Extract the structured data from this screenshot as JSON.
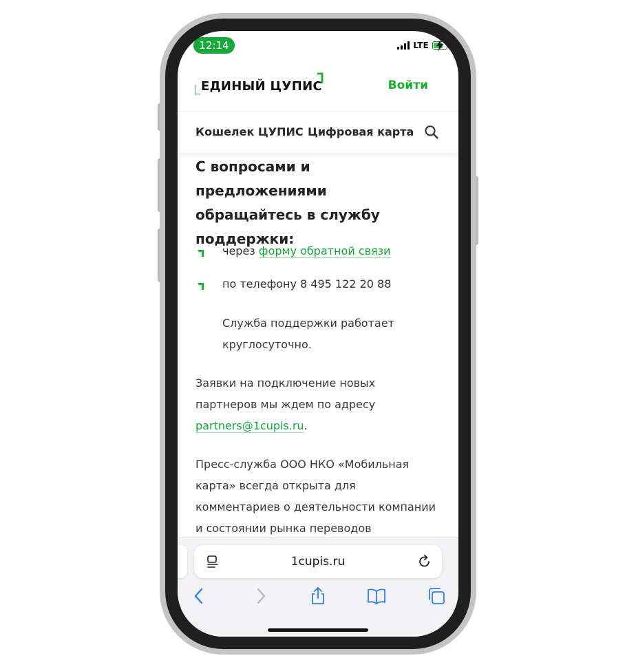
{
  "status_bar": {
    "time": "12:14",
    "network": "LTE"
  },
  "header": {
    "logo": "ЕДИНЫЙ ЦУПИС",
    "login": "Войти"
  },
  "nav": {
    "items": [
      "Кошелек ЦУПИС",
      "Цифровая карта"
    ]
  },
  "content": {
    "heading_lines": [
      "С вопросами и предложениями",
      "обращайтесь в службу",
      "поддержки:"
    ],
    "item1_prefix": "через ",
    "item1_link": "форму обратной связи",
    "item2": "по телефону 8 495 122 20 88",
    "hours_lines": [
      "Служба поддержки работает",
      "круглосуточно."
    ],
    "partners_lines": [
      "Заявки на подключение новых",
      "партнеров мы ждем по адресу"
    ],
    "partners_email": "partners@1cupis.ru",
    "partners_dot": ".",
    "press_lines": [
      "Пресс-служба ООО НКО «Мобильная",
      "карта» всегда открыта для",
      "комментариев о деятельности компании",
      "и состоянии рынка переводов"
    ]
  },
  "browser": {
    "url": "1cupis.ru"
  },
  "colors": {
    "brand_green": "#17a83b",
    "link_green": "#1aaf2a",
    "time_pill": "#17a83b",
    "ios_blue": "#2f7ff2"
  }
}
